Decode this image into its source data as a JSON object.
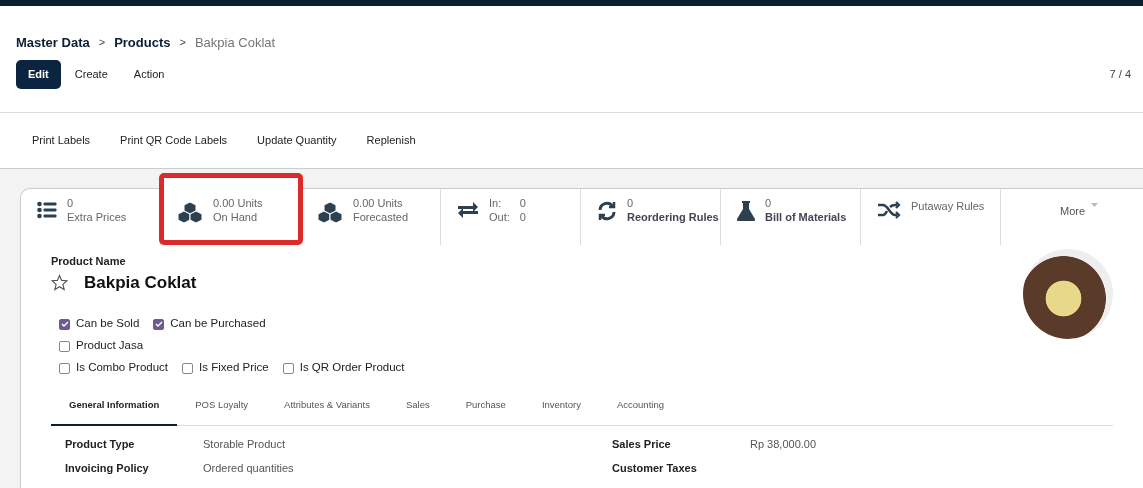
{
  "breadcrumb": [
    {
      "label": "Master Data",
      "current": false
    },
    {
      "label": "Products",
      "current": false,
      "separator": ">"
    },
    {
      "label": "Bakpia Coklat",
      "current": true,
      "separator": ">"
    }
  ],
  "control_buttons": [
    {
      "label": "Edit",
      "kind": "primary"
    },
    {
      "label": "Create",
      "kind": "plain"
    },
    {
      "label": "Action",
      "kind": "plain"
    }
  ],
  "pager": "7 / 4",
  "action_buttons": [
    "Print Labels",
    "Print QR Code Labels",
    "Update Quantity",
    "Replenish"
  ],
  "stat_buttons": [
    {
      "kind": "list",
      "value": "0",
      "label": "Extra Prices",
      "emphasized": false,
      "highlighted": false
    },
    {
      "kind": "cubes",
      "value": "0.00",
      "unit": "Units",
      "label": "On Hand",
      "emphasized": false,
      "highlighted": true
    },
    {
      "kind": "cubes",
      "value": "0.00",
      "unit": "Units",
      "label": "Forecasted",
      "emphasized": false,
      "highlighted": false
    },
    {
      "kind": "transfer",
      "rows": [
        {
          "label": "In:",
          "value": "0"
        },
        {
          "label": "Out:",
          "value": "0"
        }
      ],
      "highlighted": false
    },
    {
      "kind": "refresh",
      "value": "0",
      "label": "Reordering Rules",
      "emphasized": true,
      "highlighted": false
    },
    {
      "kind": "flask",
      "value": "0",
      "label": "Bill of Materials",
      "emphasized": true,
      "highlighted": false
    },
    {
      "kind": "shuffle",
      "label": "Putaway Rules",
      "emphasized": false,
      "highlighted": false
    },
    {
      "kind": "more",
      "label": "More",
      "highlighted": false
    }
  ],
  "product": {
    "name_label": "Product Name",
    "name": "Bakpia Coklat",
    "favorite": false
  },
  "options": [
    {
      "items": [
        {
          "label": "Can be Sold",
          "checked": true
        },
        {
          "label": "Can be Purchased",
          "checked": true
        }
      ]
    },
    {
      "items": [
        {
          "label": "Product Jasa",
          "checked": false
        }
      ]
    },
    {
      "items": [
        {
          "label": "Is Combo Product",
          "checked": false
        },
        {
          "label": "Is Fixed Price",
          "checked": false
        },
        {
          "label": "Is QR Order Product",
          "checked": false
        }
      ]
    }
  ],
  "tabs": [
    {
      "label": "General Information",
      "selected": true
    },
    {
      "label": "POS Loyalty",
      "selected": false
    },
    {
      "label": "Attributes & Variants",
      "selected": false
    },
    {
      "label": "Sales",
      "selected": false
    },
    {
      "label": "Purchase",
      "selected": false
    },
    {
      "label": "Inventory",
      "selected": false
    },
    {
      "label": "Accounting",
      "selected": false
    }
  ],
  "fields_left": [
    {
      "label": "Product Type",
      "value": "Storable Product"
    },
    {
      "label": "Invoicing Policy",
      "value": "Ordered quantities"
    }
  ],
  "fields_right": [
    {
      "label": "Sales Price",
      "value": "Rp 38,000.00"
    },
    {
      "label": "Customer Taxes"
    }
  ]
}
